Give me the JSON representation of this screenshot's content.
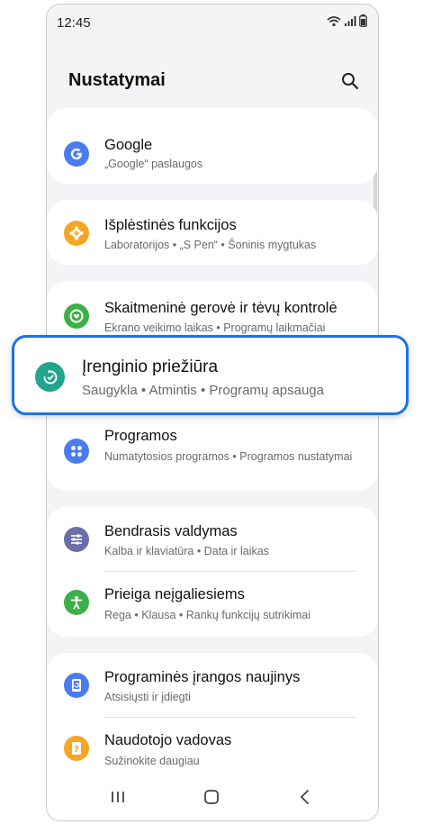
{
  "status": {
    "time": "12:45"
  },
  "header": {
    "title": "Nustatymai"
  },
  "settings": {
    "google": {
      "title": "Google",
      "subtitle": "„Google“ paslaugos",
      "icon": "google-icon",
      "color": "#4a7cf0"
    },
    "advanced": {
      "title": "Išplėstinės funkcijos",
      "subtitle": "Laboratorijos  •  „S Pen“  •  Šoninis mygtukas",
      "icon": "gear-plus-icon",
      "color": "#f5a623"
    },
    "wellbeing": {
      "title": "Skaitmeninė gerovė ir tėvų kontrolė",
      "subtitle": "Ekrano veikimo laikas  •  Programų laikmačiai",
      "icon": "heart-ring-icon",
      "color": "#3eb04a"
    },
    "device_care": {
      "title": "Įrenginio priežiūra",
      "subtitle": "Saugykla  •  Atmintis  •  Programų apsauga",
      "icon": "device-care-icon",
      "color": "#1fa68d"
    },
    "apps": {
      "title": "Programos",
      "subtitle": "Numatytosios programos  •  Programos nustatymai",
      "icon": "apps-grid-icon",
      "color": "#4a7cf0"
    },
    "general": {
      "title": "Bendrasis valdymas",
      "subtitle": "Kalba ir klaviatūra  •  Data ir laikas",
      "icon": "sliders-icon",
      "color": "#6b6fa8"
    },
    "accessibility": {
      "title": "Prieiga neįgaliesiems",
      "subtitle": "Rega  •  Klausa  •  Rankų funkcijų sutrikimai",
      "icon": "accessibility-icon",
      "color": "#3eb04a"
    },
    "software_update": {
      "title": "Programinės įrangos naujinys",
      "subtitle": "Atsisiųsti ir įdiegti",
      "icon": "update-icon",
      "color": "#4a7cf0"
    },
    "tips": {
      "title": "Naudotojo vadovas",
      "subtitle": "Sužinokite daugiau",
      "icon": "user-guide-icon",
      "color": "#f5a623"
    }
  }
}
